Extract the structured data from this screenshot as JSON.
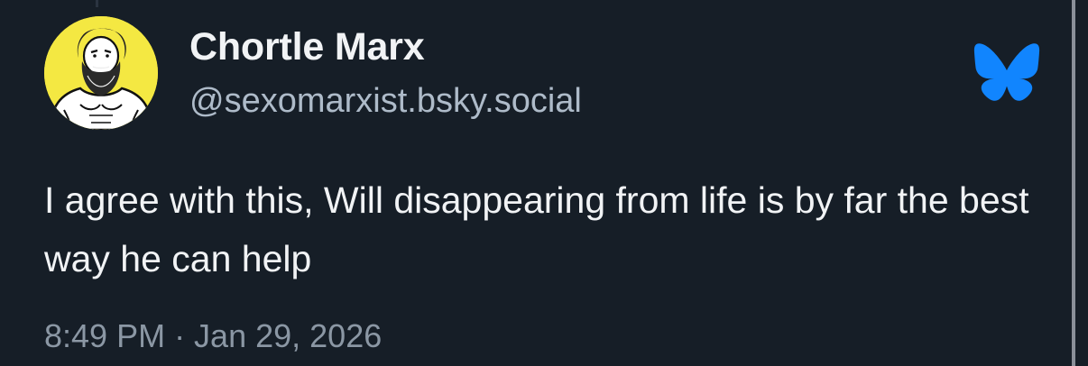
{
  "post": {
    "author": {
      "display_name": "Chortle Marx",
      "handle": "@sexomarxist.bsky.social",
      "avatar_icon": "bearded-muscular-man-avatar"
    },
    "text": "I agree with this, Will disappearing from life is by far the best way he can help",
    "timestamp": "8:49 PM · Jan 29, 2026",
    "platform_icon": "bluesky-butterfly-icon"
  },
  "colors": {
    "background": "#161e27",
    "text_primary": "#f1f3f5",
    "text_secondary": "#aebbc9",
    "timestamp": "#8b97a4",
    "bluesky_blue": "#1185fe",
    "avatar_bg": "#f4e842"
  }
}
